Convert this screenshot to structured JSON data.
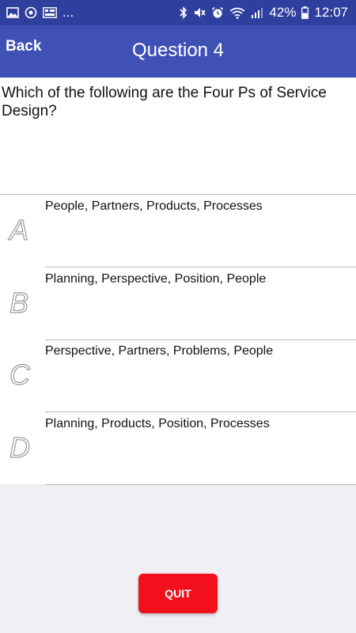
{
  "status_bar": {
    "left_icons": [
      "image-icon",
      "sync-icon",
      "grid-app-icon"
    ],
    "overflow_text": "...",
    "right_icons": [
      "bluetooth-icon",
      "mute-icon",
      "alarm-icon",
      "wifi-icon",
      "signal-icon",
      "battery-icon"
    ],
    "battery": "42%",
    "time": "12:07"
  },
  "app_bar": {
    "back_label": "Back",
    "title": "Question 4"
  },
  "question": {
    "text": "Which of the following are the Four Ps of Service Design?"
  },
  "options": [
    {
      "letter": "A",
      "text": "People, Partners, Products, Processes"
    },
    {
      "letter": "B",
      "text": "Planning, Perspective, Position, People"
    },
    {
      "letter": "C",
      "text": "Perspective, Partners, Problems, People"
    },
    {
      "letter": "D",
      "text": "Planning, Products, Position, Processes"
    }
  ],
  "quit_label": "QUIT",
  "colors": {
    "status_bar": "#2f3f9e",
    "app_bar": "#3f51b5",
    "quit_button": "#f2101d",
    "background": "#efeff4"
  }
}
